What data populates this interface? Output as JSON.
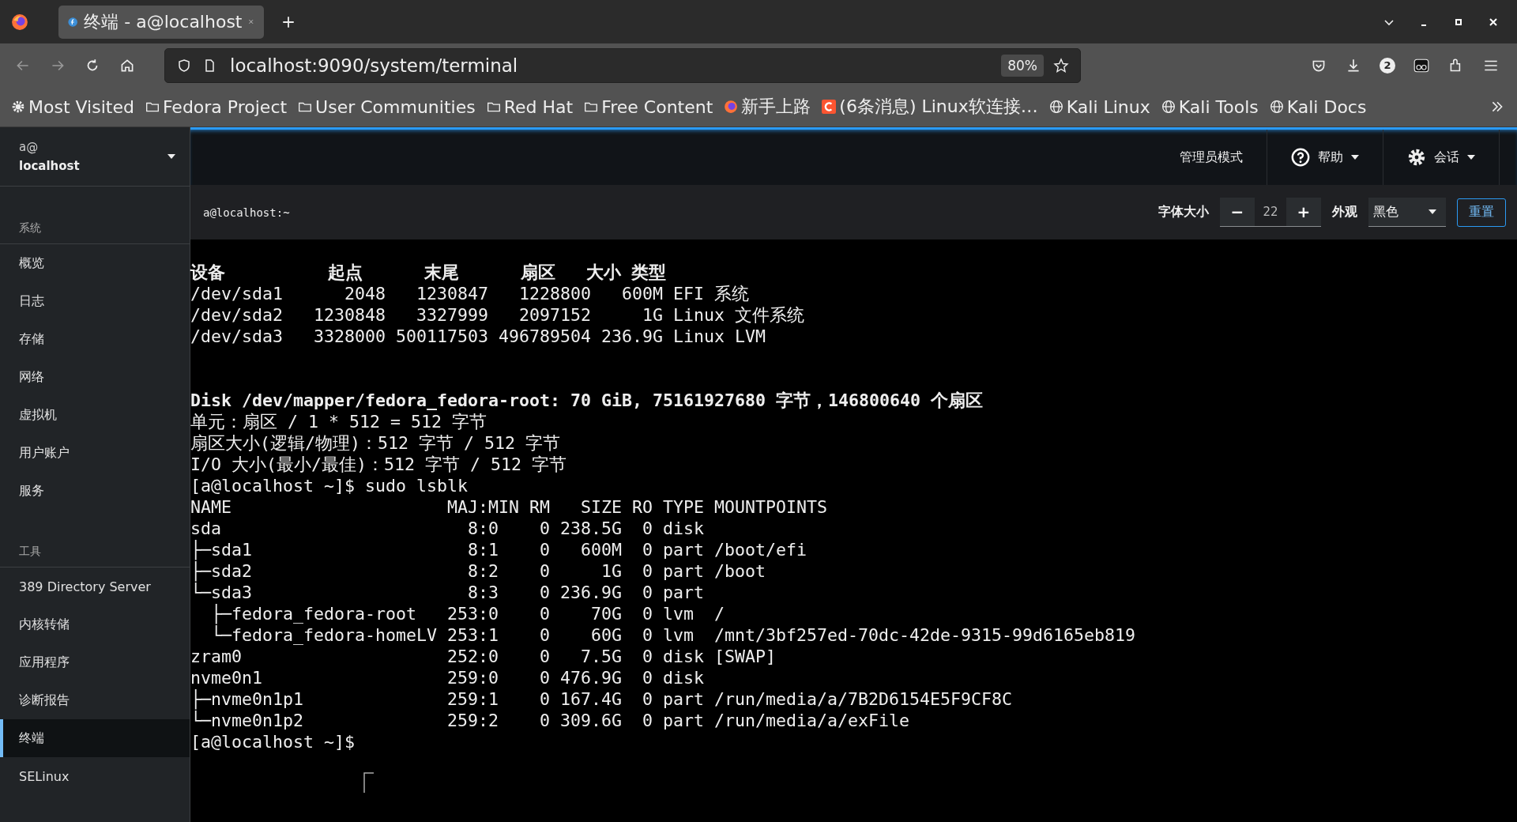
{
  "browser": {
    "tabs": [
      {
        "title": "终端 - a@localhost",
        "selected": true
      }
    ],
    "url": "localhost:9090/system/terminal",
    "zoom": "80%",
    "badge": "2",
    "bookmarks": [
      {
        "label": "Most Visited",
        "kind": "gear"
      },
      {
        "label": "Fedora Project",
        "kind": "folder"
      },
      {
        "label": "User Communities",
        "kind": "folder"
      },
      {
        "label": "Red Hat",
        "kind": "folder"
      },
      {
        "label": "Free Content",
        "kind": "folder"
      },
      {
        "label": "新手上路",
        "kind": "firefox"
      },
      {
        "label": "(6条消息) Linux软连接…",
        "kind": "csdn"
      },
      {
        "label": "Kali Linux",
        "kind": "globe"
      },
      {
        "label": "Kali Tools",
        "kind": "globe"
      },
      {
        "label": "Kali Docs",
        "kind": "globe"
      }
    ]
  },
  "host": {
    "user": "a@",
    "name": "localhost"
  },
  "nav": [
    {
      "title": "系统",
      "items": [
        {
          "label": "概览",
          "selected": false
        },
        {
          "label": "日志",
          "selected": false
        },
        {
          "label": "存储",
          "selected": false
        },
        {
          "label": "网络",
          "selected": false
        },
        {
          "label": "虚拟机",
          "selected": false
        },
        {
          "label": "用户账户",
          "selected": false
        },
        {
          "label": "服务",
          "selected": false
        }
      ]
    },
    {
      "title": "工具",
      "items": [
        {
          "label": "389 Directory Server",
          "selected": false
        },
        {
          "label": "内核转储",
          "selected": false
        },
        {
          "label": "应用程序",
          "selected": false
        },
        {
          "label": "诊断报告",
          "selected": false
        },
        {
          "label": "终端",
          "selected": true
        },
        {
          "label": "SELinux",
          "selected": false
        }
      ]
    }
  ],
  "header": {
    "admin": "管理员模式",
    "help": "帮助",
    "session": "会话"
  },
  "terminal": {
    "title": "a@localhost:~",
    "font_size_label": "字体大小",
    "decrease": "−",
    "font_size": "22",
    "increase": "+",
    "appearance_label": "外观",
    "appearance": "黑色",
    "reset": "重置",
    "blocks": [
      [
        {
          "text": "设备          起点      末尾      扇区   大小 类型",
          "bold": true
        },
        {
          "text": "/dev/sda1      2048   1230847   1228800   600M EFI 系统",
          "bold": false
        },
        {
          "text": "/dev/sda2   1230848   3327999   2097152     1G Linux 文件系统",
          "bold": false
        },
        {
          "text": "/dev/sda3   3328000 500117503 496789504 236.9G Linux LVM",
          "bold": false
        }
      ],
      [
        {
          "text": "Disk /dev/mapper/fedora_fedora-root: 70 GiB, 75161927680 字节，146800640 个扇区",
          "bold": true
        },
        {
          "text": "单元：扇区 / 1 * 512 = 512 字节",
          "bold": false
        },
        {
          "text": "扇区大小(逻辑/物理)：512 字节 / 512 字节",
          "bold": false
        },
        {
          "text": "I/O 大小(最小/最佳)：512 字节 / 512 字节",
          "bold": false
        },
        {
          "text": "[a@localhost ~]$ sudo lsblk",
          "bold": false
        },
        {
          "text": "NAME                     MAJ:MIN RM   SIZE RO TYPE MOUNTPOINTS",
          "bold": false
        },
        {
          "text": "sda                        8:0    0 238.5G  0 disk",
          "bold": false
        },
        {
          "text": "├─sda1                     8:1    0   600M  0 part /boot/efi",
          "bold": false
        },
        {
          "text": "├─sda2                     8:2    0     1G  0 part /boot",
          "bold": false
        },
        {
          "text": "└─sda3                     8:3    0 236.9G  0 part",
          "bold": false
        },
        {
          "text": "  ├─fedora_fedora-root   253:0    0    70G  0 lvm  /",
          "bold": false
        },
        {
          "text": "  └─fedora_fedora-homeLV 253:1    0    60G  0 lvm  /mnt/3bf257ed-70dc-42de-9315-99d6165eb819",
          "bold": false
        },
        {
          "text": "zram0                    252:0    0   7.5G  0 disk [SWAP]",
          "bold": false
        },
        {
          "text": "nvme0n1                  259:0    0 476.9G  0 disk",
          "bold": false
        },
        {
          "text": "├─nvme0n1p1              259:1    0 167.4G  0 part /run/media/a/7B2D6154E5F9CF8C",
          "bold": false
        },
        {
          "text": "└─nvme0n1p2              259:2    0 309.6G  0 part /run/media/a/exFile",
          "bold": false
        },
        {
          "text": "[a@localhost ~]$",
          "bold": false
        }
      ]
    ]
  }
}
